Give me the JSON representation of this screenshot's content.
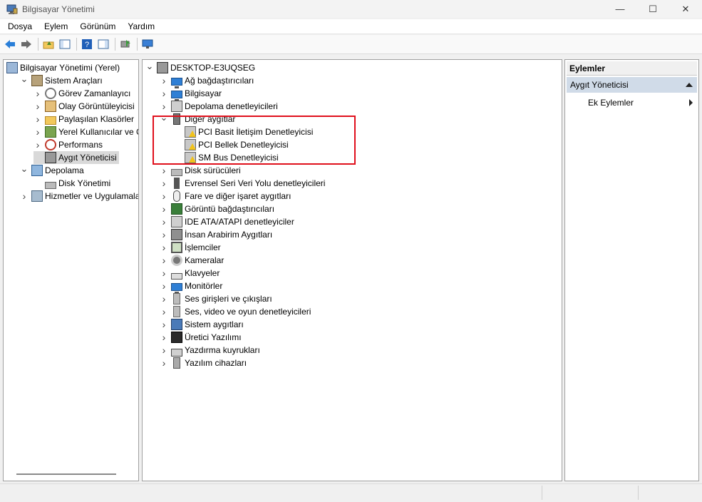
{
  "window": {
    "title": "Bilgisayar Yönetimi",
    "controls": {
      "minimize": "—",
      "maximize": "☐",
      "close": "✕"
    }
  },
  "menu": [
    "Dosya",
    "Eylem",
    "Görünüm",
    "Yardım"
  ],
  "left_tree": [
    {
      "label": "Bilgisayar Yönetimi (Yerel)",
      "icon": "computer-management-icon",
      "level": 0,
      "expander": ""
    },
    {
      "label": "Sistem Araçları",
      "icon": "system-tools-icon",
      "level": 1,
      "expander": "expanded"
    },
    {
      "label": "Görev Zamanlayıcı",
      "icon": "task-scheduler-icon",
      "level": 2,
      "expander": "collapsed"
    },
    {
      "label": "Olay Görüntüleyicisi",
      "icon": "event-viewer-icon",
      "level": 2,
      "expander": "collapsed"
    },
    {
      "label": "Paylaşılan Klasörler",
      "icon": "shared-folders-icon",
      "level": 2,
      "expander": "collapsed"
    },
    {
      "label": "Yerel Kullanıcılar ve Gru",
      "icon": "local-users-icon",
      "level": 2,
      "expander": "collapsed"
    },
    {
      "label": "Performans",
      "icon": "performance-icon",
      "level": 2,
      "expander": "collapsed"
    },
    {
      "label": "Aygıt Yöneticisi",
      "icon": "device-manager-icon",
      "level": 2,
      "expander": "",
      "selected": true
    },
    {
      "label": "Depolama",
      "icon": "storage-icon",
      "level": 1,
      "expander": "expanded"
    },
    {
      "label": "Disk Yönetimi",
      "icon": "disk-management-icon",
      "level": 2,
      "expander": ""
    },
    {
      "label": "Hizmetler ve Uygulamalar",
      "icon": "services-icon",
      "level": 1,
      "expander": "collapsed"
    }
  ],
  "device_tree": {
    "root": "DESKTOP-E3UQSEG",
    "categories": [
      {
        "label": "Ağ bağdaştırıcıları",
        "icon": "network-adapter-icon"
      },
      {
        "label": "Bilgisayar",
        "icon": "computer-icon"
      },
      {
        "label": "Depolama denetleyicileri",
        "icon": "storage-controller-icon"
      },
      {
        "label": "Diğer aygıtlar",
        "icon": "other-devices-icon",
        "expanded": true,
        "children": [
          "PCI Basit İletişim Denetleyicisi",
          "PCI Bellek Denetleyicisi",
          "SM Bus Denetleyicisi"
        ]
      },
      {
        "label": "Disk sürücüleri",
        "icon": "disk-drive-icon"
      },
      {
        "label": "Evrensel Seri Veri Yolu denetleyicileri",
        "icon": "usb-icon"
      },
      {
        "label": "Fare ve diğer işaret aygıtları",
        "icon": "mouse-icon"
      },
      {
        "label": "Görüntü bağdaştırıcıları",
        "icon": "display-adapter-icon"
      },
      {
        "label": "IDE ATA/ATAPI denetleyiciler",
        "icon": "ide-icon"
      },
      {
        "label": "İnsan Arabirim Aygıtları",
        "icon": "hid-icon"
      },
      {
        "label": "İşlemciler",
        "icon": "processor-icon"
      },
      {
        "label": "Kameralar",
        "icon": "camera-icon"
      },
      {
        "label": "Klavyeler",
        "icon": "keyboard-icon"
      },
      {
        "label": "Monitörler",
        "icon": "monitor-icon"
      },
      {
        "label": "Ses girişleri ve çıkışları",
        "icon": "audio-io-icon"
      },
      {
        "label": "Ses, video ve oyun denetleyicileri",
        "icon": "sound-video-icon"
      },
      {
        "label": "Sistem aygıtları",
        "icon": "system-devices-icon"
      },
      {
        "label": "Üretici Yazılımı",
        "icon": "firmware-icon"
      },
      {
        "label": "Yazdırma kuyrukları",
        "icon": "print-queue-icon"
      },
      {
        "label": "Yazılım cihazları",
        "icon": "software-device-icon"
      }
    ]
  },
  "actions": {
    "header": "Eylemler",
    "section": "Aygıt Yöneticisi",
    "more": "Ek Eylemler"
  },
  "colors": {
    "highlight_box": "#e0101c",
    "action_selected": "#d0dbe8"
  }
}
